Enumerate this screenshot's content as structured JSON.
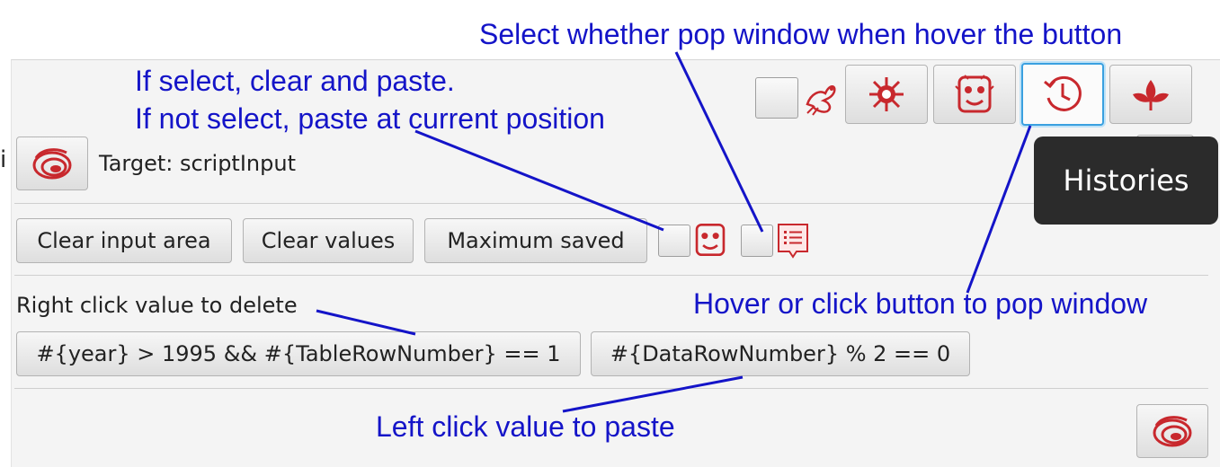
{
  "annotations": {
    "popup_hover": "Select whether pop window when hover the button",
    "clear_paste_1": "If select, clear and paste.",
    "clear_paste_2": "If not select, paste at current position",
    "hover_click": "Hover or click button to pop window",
    "left_click": "Left click value to paste"
  },
  "target": {
    "label": "Target: scriptInput"
  },
  "toolbar": {
    "clear_input": "Clear input area",
    "clear_values": "Clear values",
    "maximum_saved": "Maximum saved"
  },
  "values_section": {
    "hint": "Right click value to delete",
    "values": [
      "#{year} > 1995 && #{TableRowNumber} == 1",
      "#{DataRowNumber} % 2 == 0"
    ]
  },
  "tooltip": {
    "text": "Histories"
  },
  "left_cut_text": "i",
  "colors": {
    "annotation": "#1414c8",
    "icon_red": "#c8282d",
    "focus": "#3aa0e0",
    "tooltip_bg": "#2b2b2b"
  }
}
